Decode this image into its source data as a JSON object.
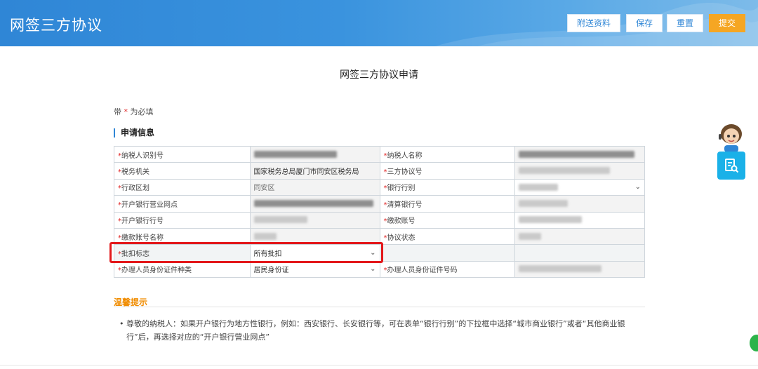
{
  "header": {
    "title": "网签三方协议",
    "buttons": {
      "attach": "附送资料",
      "save": "保存",
      "reset": "重置",
      "submit": "提交"
    }
  },
  "page_title": "网签三方协议申请",
  "required_note": {
    "prefix": "带",
    "star": "*",
    "suffix": "为必填"
  },
  "section_title": "申请信息",
  "form": {
    "rows": [
      {
        "label1": "纳税人识别号",
        "value1": "",
        "label2": "纳税人名称",
        "value2": ""
      },
      {
        "label1": "税务机关",
        "value1": "国家税务总局厦门市同安区税务局",
        "label2": "三方协议号",
        "value2": ""
      },
      {
        "label1": "行政区划",
        "value1": "同安区",
        "label2": "银行行别",
        "value2": ""
      },
      {
        "label1": "开户银行营业网点",
        "value1": "",
        "label2": "清算银行号",
        "value2": ""
      },
      {
        "label1": "开户银行行号",
        "value1": "",
        "label2": "缴款账号",
        "value2": ""
      },
      {
        "label1": "缴款账号名称",
        "value1": "",
        "label2": "协议状态",
        "value2": ""
      },
      {
        "label1": "批扣标志",
        "value1": "所有批扣",
        "label2": "",
        "value2": ""
      },
      {
        "label1": "办理人员身份证件种类",
        "value1": "居民身份证",
        "label2": "办理人员身份证件号码",
        "value2": ""
      }
    ]
  },
  "tips": {
    "title": "温馨提示",
    "text": "• 尊敬的纳税人：如果开户银行为地方性银行，例如：西安银行、长安银行等，可在表单“银行行别”的下拉框中选择“城市商业银行”或者“其他商业银行”后，再选择对应的“开户银行营业网点”"
  },
  "icons": {
    "dropdown": "chevron-down-icon",
    "assistant": "customer-service-avatar-icon",
    "float": "document-search-icon"
  },
  "colors": {
    "header": "#2f86d6",
    "submit": "#f5a623",
    "highlight": "#e3181b",
    "tips_title": "#f08c00",
    "float": "#1ab1e8"
  }
}
